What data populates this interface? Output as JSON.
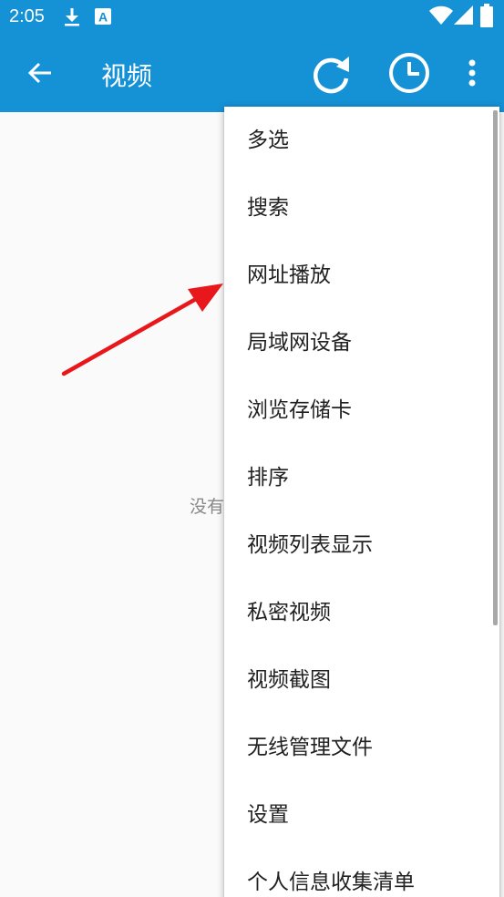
{
  "status_bar": {
    "time": "2:05",
    "icons": [
      "download-icon",
      "a-icon",
      "wifi-icon",
      "signal-icon",
      "battery-icon"
    ]
  },
  "app_bar": {
    "title": "视频",
    "icons": [
      "back-arrow-icon",
      "refresh-icon",
      "history-clock-icon",
      "overflow-menu-icon"
    ]
  },
  "main": {
    "empty_text": "没有"
  },
  "menu": {
    "items": [
      {
        "label": "多选"
      },
      {
        "label": "搜索"
      },
      {
        "label": "网址播放"
      },
      {
        "label": "局域网设备"
      },
      {
        "label": "浏览存储卡"
      },
      {
        "label": "排序"
      },
      {
        "label": "视频列表显示"
      },
      {
        "label": "私密视频"
      },
      {
        "label": "视频截图"
      },
      {
        "label": "无线管理文件"
      },
      {
        "label": "设置"
      },
      {
        "label": "个人信息收集清单"
      }
    ]
  },
  "annotation": {
    "arrow_color": "#e8171b"
  },
  "colors": {
    "primary": "#1591d6",
    "menu_bg": "#ffffff",
    "text": "#212121"
  }
}
